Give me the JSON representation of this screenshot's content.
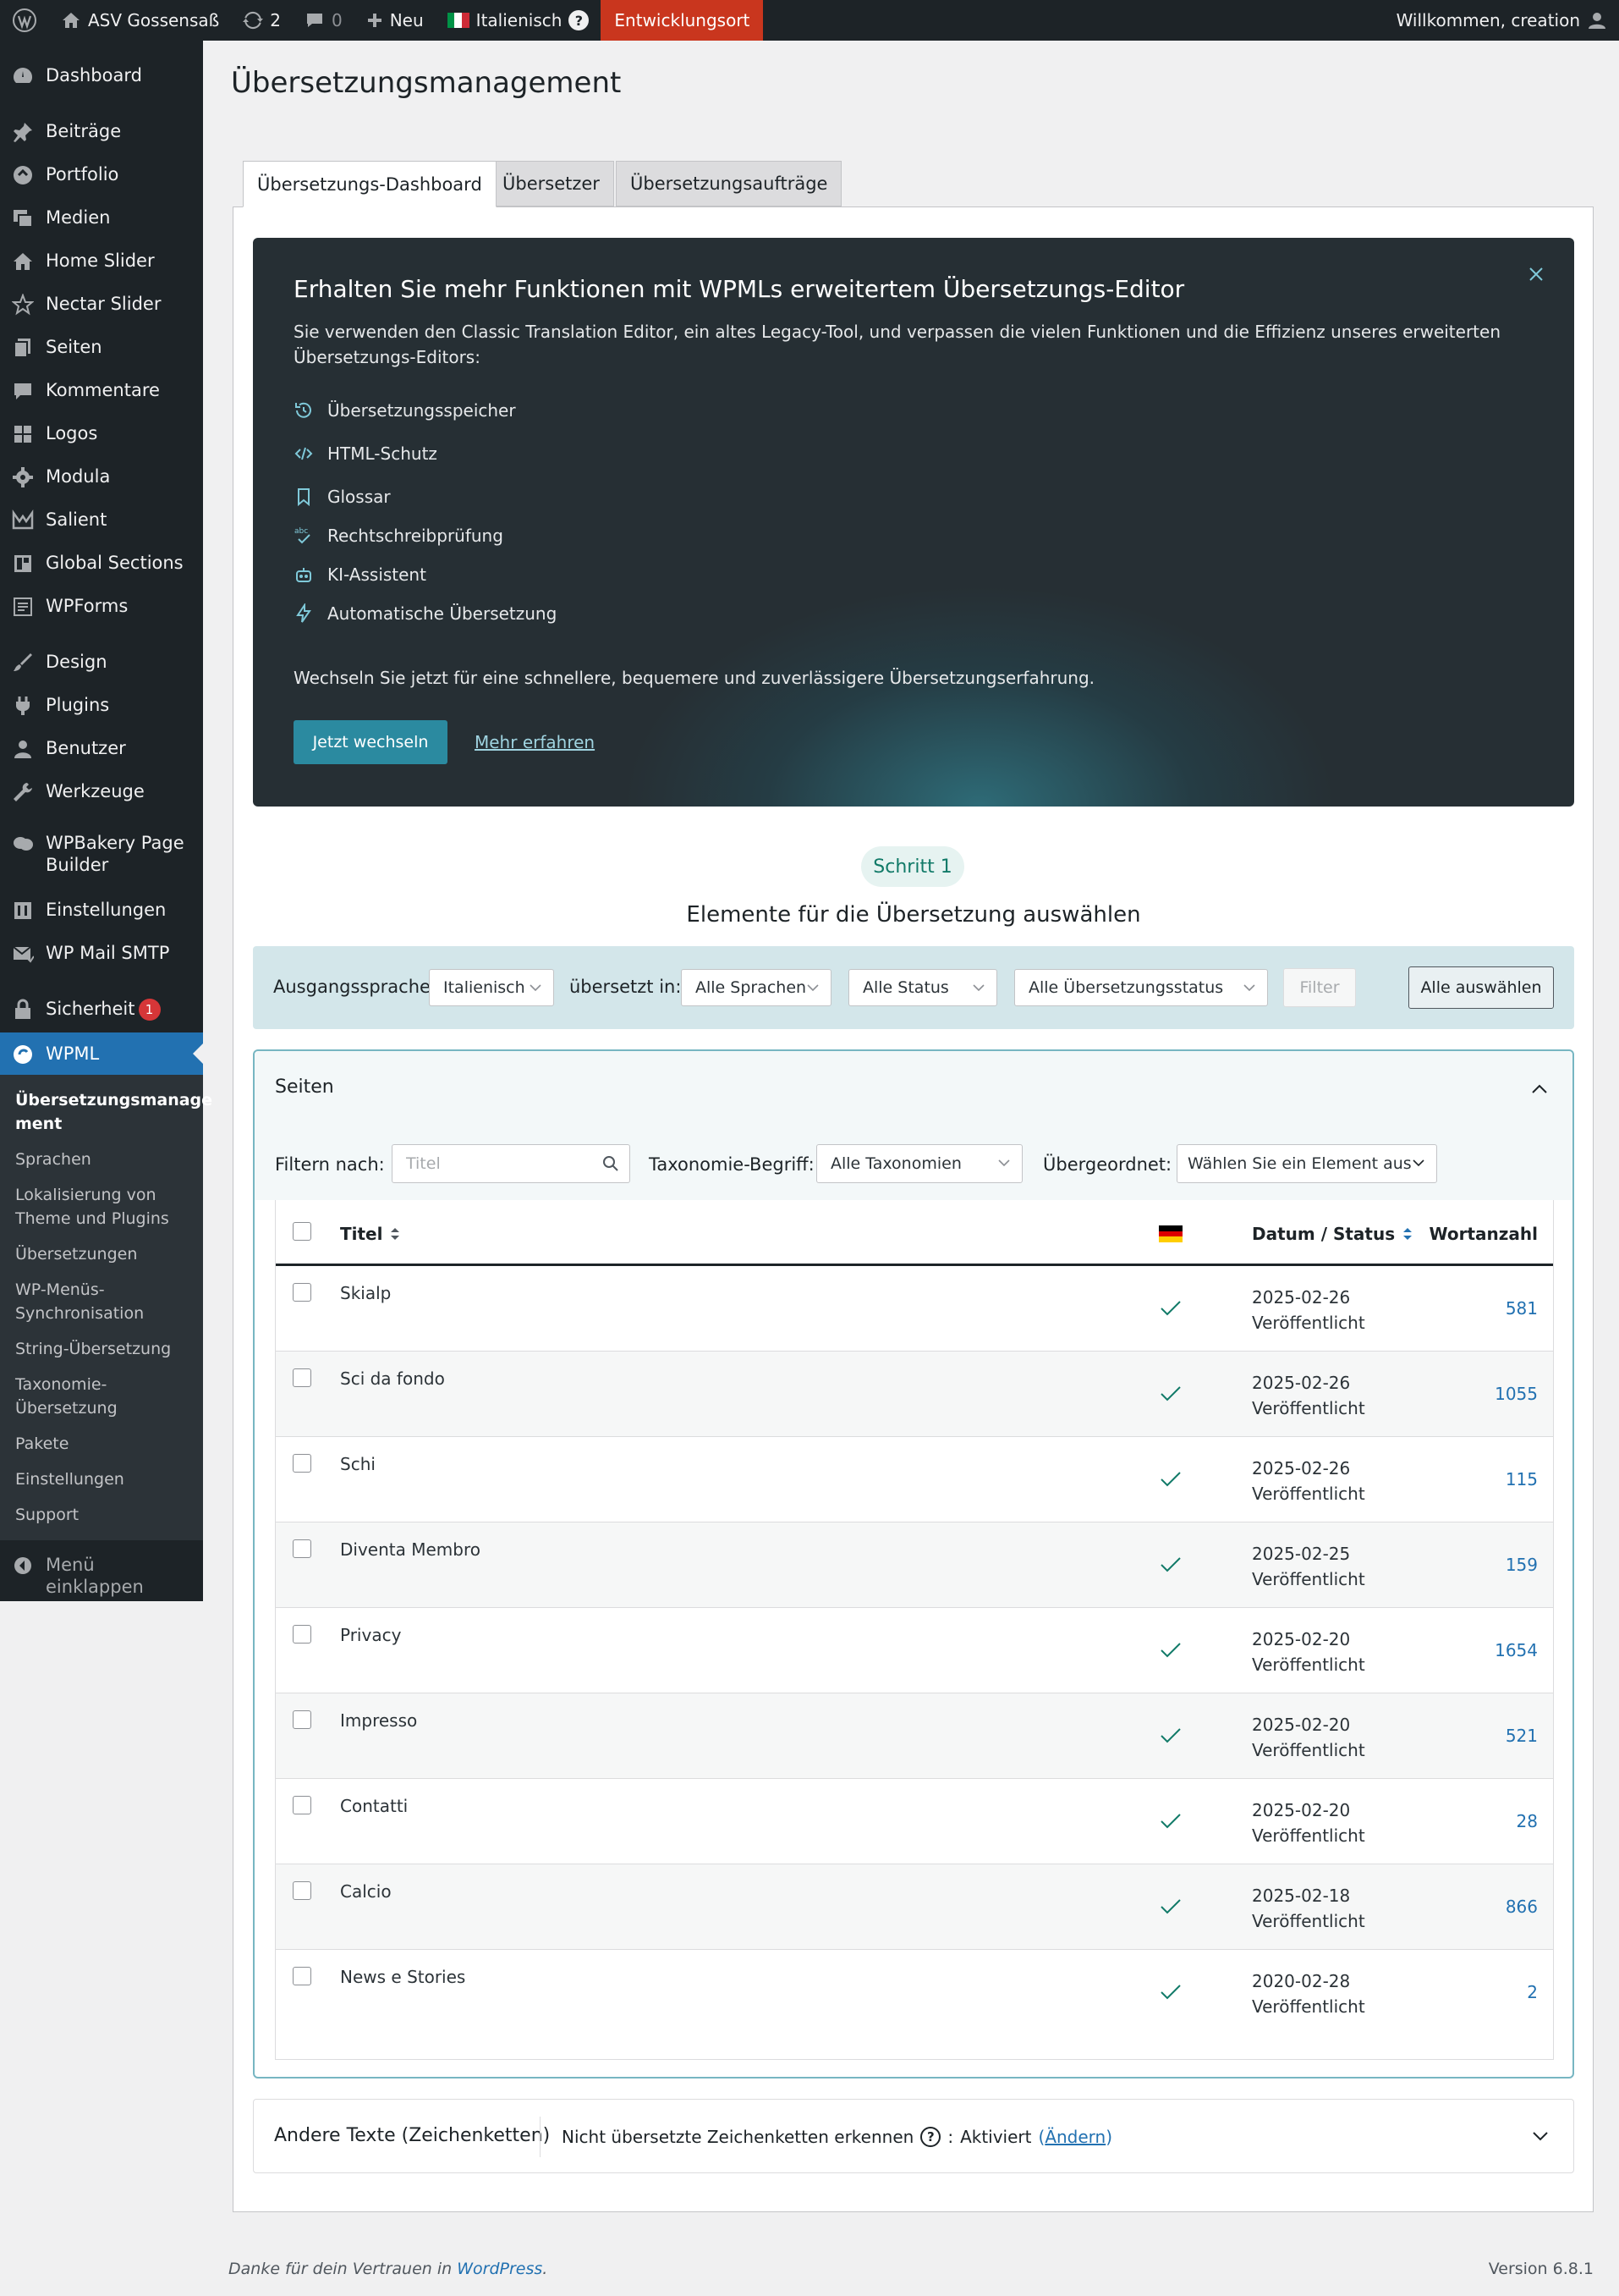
{
  "adminbar": {
    "site_name": "ASV Gossensaß",
    "updates_count": "2",
    "comments_count": "0",
    "new_label": "Neu",
    "language": "Italienisch",
    "language_help": "?",
    "environment": "Entwicklungsort",
    "greeting": "Willkommen, creation"
  },
  "sidebar": {
    "items": [
      {
        "label": "Dashboard",
        "icon": "dashboard-icon"
      },
      {
        "label": "Beiträge",
        "icon": "pin-icon"
      },
      {
        "label": "Portfolio",
        "icon": "portfolio-icon"
      },
      {
        "label": "Medien",
        "icon": "media-icon"
      },
      {
        "label": "Home Slider",
        "icon": "home-icon"
      },
      {
        "label": "Nectar Slider",
        "icon": "star-icon"
      },
      {
        "label": "Seiten",
        "icon": "pages-icon"
      },
      {
        "label": "Kommentare",
        "icon": "comments-icon"
      },
      {
        "label": "Logos",
        "icon": "grid-icon"
      },
      {
        "label": "Modula",
        "icon": "gear-icon"
      },
      {
        "label": "Salient",
        "icon": "chart-icon"
      },
      {
        "label": "Global Sections",
        "icon": "layout-icon"
      },
      {
        "label": "WPForms",
        "icon": "form-icon"
      },
      {
        "label": "Design",
        "icon": "brush-icon"
      },
      {
        "label": "Plugins",
        "icon": "plugin-icon"
      },
      {
        "label": "Benutzer",
        "icon": "user-icon"
      },
      {
        "label": "Werkzeuge",
        "icon": "wrench-icon"
      },
      {
        "label": "WPBakery Page Builder",
        "icon": "cloud-icon"
      },
      {
        "label": "Einstellungen",
        "icon": "settings-icon"
      },
      {
        "label": "WP Mail SMTP",
        "icon": "mail-icon"
      },
      {
        "label": "Sicherheit",
        "icon": "lock-icon",
        "badge": "1"
      },
      {
        "label": "WPML",
        "icon": "wpml-icon"
      }
    ],
    "submenu": [
      "Übersetzungsmanage ment",
      "Sprachen",
      "Lokalisierung von Theme und Plugins",
      "Übersetzungen",
      "WP-Menüs-Synchronisation",
      "String-Übersetzung",
      "Taxonomie-Übersetzung",
      "Pakete",
      "Einstellungen",
      "Support"
    ],
    "collapse_label": "Menü einklappen"
  },
  "page": {
    "title": "Übersetzungsmanagement",
    "tabs": [
      "Übersetzungs-Dashboard",
      "Übersetzer",
      "Übersetzungsaufträge"
    ]
  },
  "banner": {
    "title": "Erhalten Sie mehr Funktionen mit WPMLs erweitertem Übersetzungs-Editor",
    "description": "Sie verwenden den Classic Translation Editor, ein altes Legacy-Tool, und verpassen die vielen Funktionen und die Effizienz unseres erweiterten Übersetzungs-Editors:",
    "features": [
      {
        "label": "Übersetzungsspeicher",
        "icon": "memory-icon"
      },
      {
        "label": "HTML-Schutz",
        "icon": "code-icon"
      },
      {
        "label": "Glossar",
        "icon": "bookmark-icon"
      },
      {
        "label": "Rechtschreibprüfung",
        "icon": "spellcheck-icon"
      },
      {
        "label": "KI-Assistent",
        "icon": "robot-icon"
      },
      {
        "label": "Automatische Übersetzung",
        "icon": "lightning-icon"
      }
    ],
    "switch_text": "Wechseln Sie jetzt für eine schnellere, bequemere und zuverlässigere Übersetzungserfahrung.",
    "switch_button": "Jetzt wechseln",
    "learn_more": "Mehr erfahren"
  },
  "step": {
    "badge": "Schritt 1",
    "title": "Elemente für die Übersetzung auswählen"
  },
  "filter": {
    "source_label": "Ausgangssprache:",
    "source_value": "Italienisch",
    "translated_label": "übersetzt in:",
    "languages_value": "Alle Sprachen",
    "status_value": "Alle Status",
    "translation_status_value": "Alle Übersetzungsstatus",
    "filter_button": "Filter",
    "select_all_button": "Alle auswählen"
  },
  "pages": {
    "title": "Seiten",
    "filter_by_label": "Filtern nach:",
    "title_placeholder": "Titel",
    "taxonomy_label": "Taxonomie-Begriff:",
    "taxonomy_value": "Alle Taxonomien",
    "parent_label": "Übergeordnet:",
    "parent_value": "Wählen Sie ein Element aus",
    "columns": {
      "title": "Titel",
      "date_status": "Datum / Status",
      "word_count": "Wortanzahl"
    },
    "rows": [
      {
        "title": "Skialp",
        "date": "2025-02-26",
        "status": "Veröffentlicht",
        "words": "581"
      },
      {
        "title": "Sci da fondo",
        "date": "2025-02-26",
        "status": "Veröffentlicht",
        "words": "1055"
      },
      {
        "title": "Schi",
        "date": "2025-02-26",
        "status": "Veröffentlicht",
        "words": "115"
      },
      {
        "title": "Diventa Membro",
        "date": "2025-02-25",
        "status": "Veröffentlicht",
        "words": "159"
      },
      {
        "title": "Privacy",
        "date": "2025-02-20",
        "status": "Veröffentlicht",
        "words": "1654"
      },
      {
        "title": "Impresso",
        "date": "2025-02-20",
        "status": "Veröffentlicht",
        "words": "521"
      },
      {
        "title": "Contatti",
        "date": "2025-02-20",
        "status": "Veröffentlicht",
        "words": "28"
      },
      {
        "title": "Calcio",
        "date": "2025-02-18",
        "status": "Veröffentlicht",
        "words": "866"
      },
      {
        "title": "News e Stories",
        "date": "2020-02-28",
        "status": "Veröffentlicht",
        "words": "2"
      }
    ]
  },
  "other": {
    "title": "Andere Texte (Zeichenketten)",
    "detect_label": "Nicht übersetzte Zeichenketten erkennen",
    "help": "?",
    "colon": ":",
    "status": "Aktiviert",
    "change_open": "(",
    "change_link": "Ändern",
    "change_close": ")"
  },
  "footer": {
    "thanks_prefix": "Danke für dein Vertrauen in",
    "thanks_link": "WordPress",
    "thanks_suffix": ".",
    "version": "Version 6.8.1"
  },
  "colors": {
    "adminbar": "#1d2327",
    "accent": "#2271b1",
    "environment": "#c9361e",
    "banner_button": "#2b8aa0",
    "check": "#117a68"
  }
}
